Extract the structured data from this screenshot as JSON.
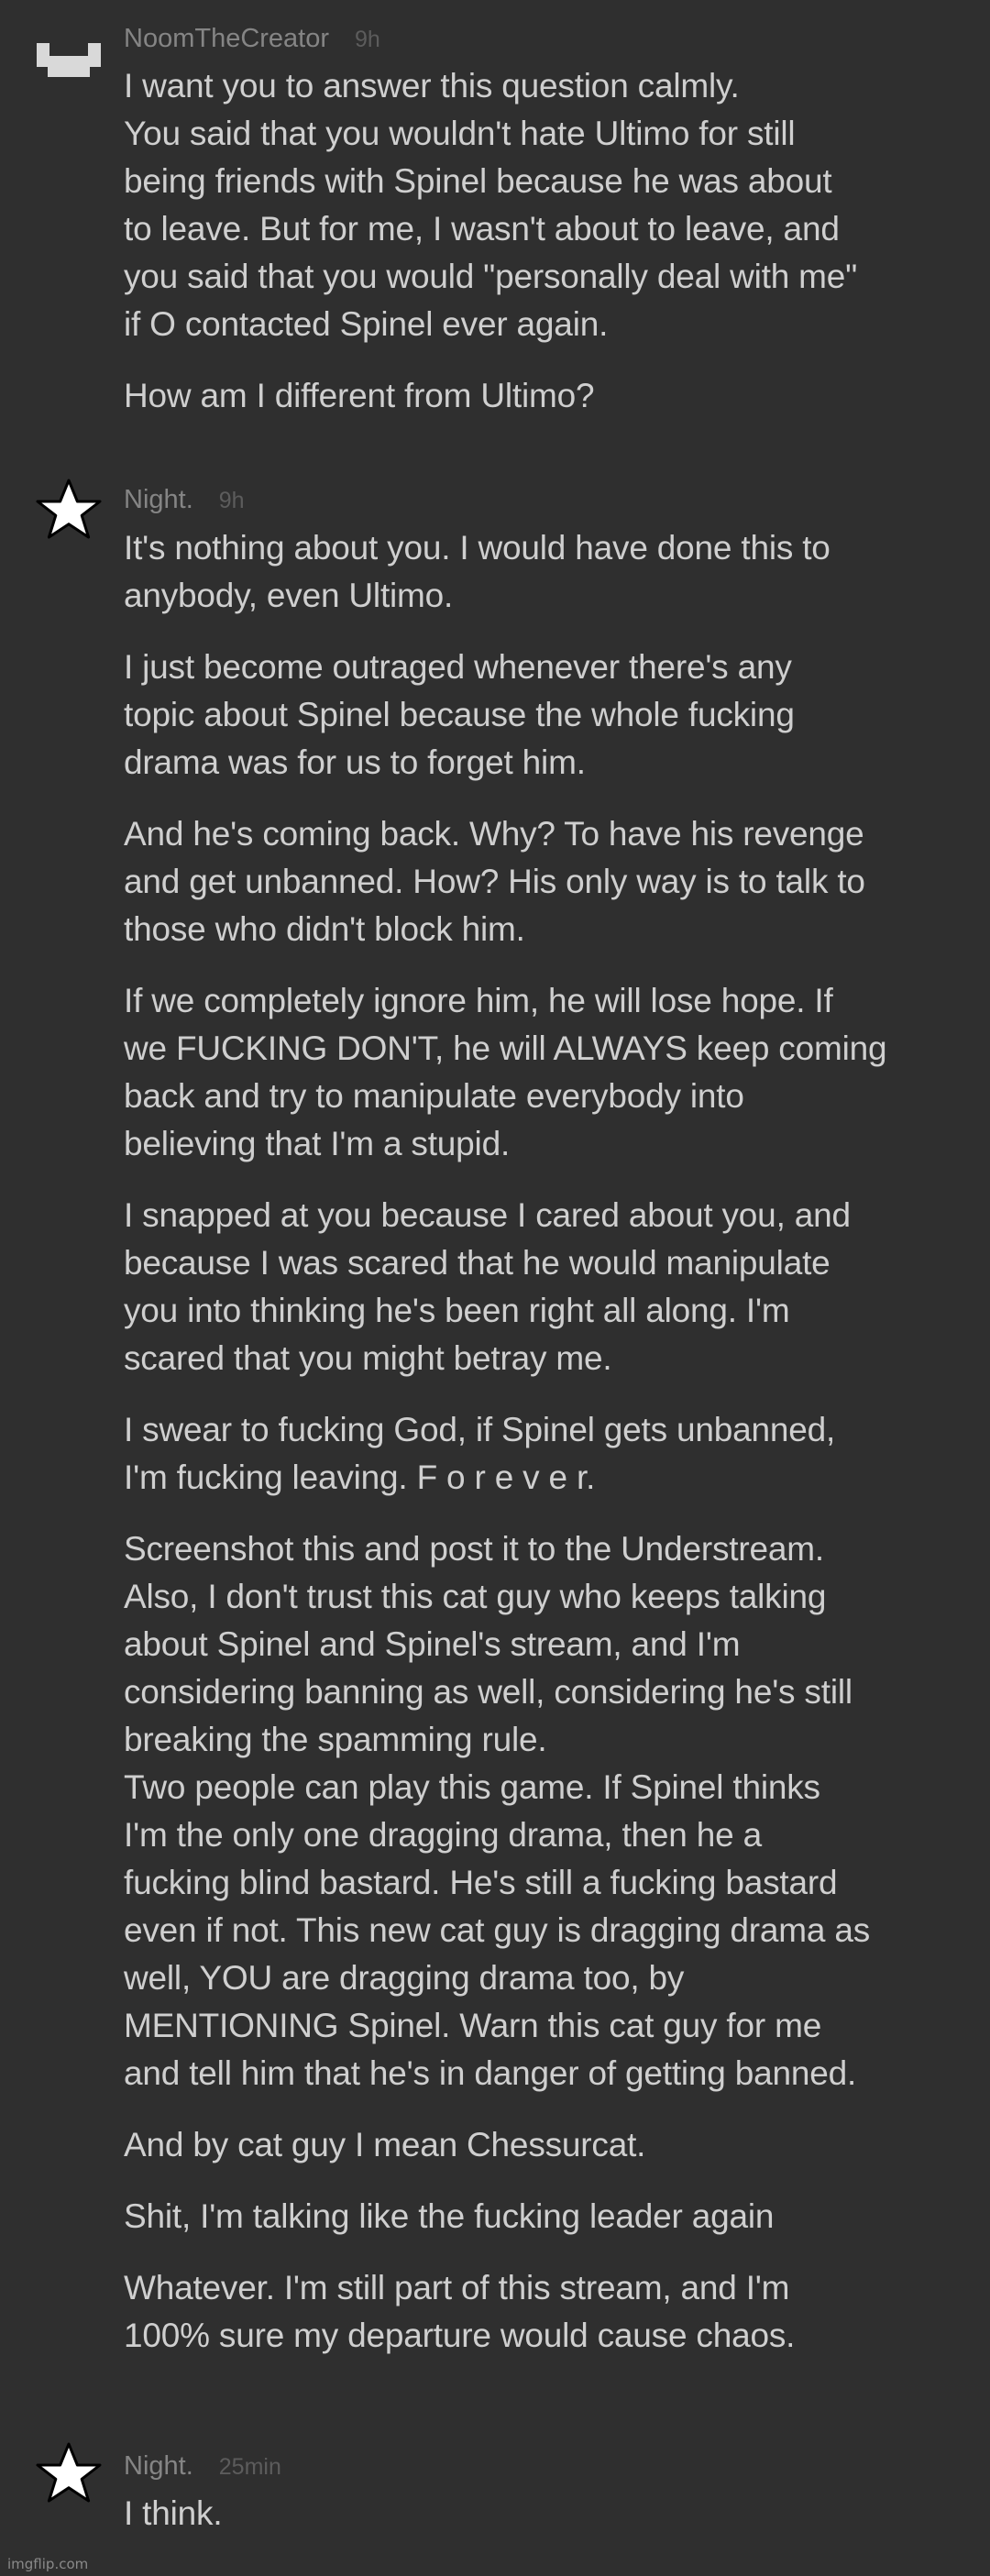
{
  "comments": [
    {
      "author": "NoomTheCreator",
      "time": "9h",
      "avatar_icon": "pixel-face-icon",
      "paragraphs": [
        "I want you to answer this question calmly.\nYou said that you wouldn't hate Ultimo for still\nbeing friends with Spinel because he was about\nto leave. But for me, I wasn't about to leave, and\nyou said that you would \"personally deal with me\"\nif O contacted Spinel ever again.",
        "How am I different from Ultimo?"
      ]
    },
    {
      "author": "Night.",
      "time": "9h",
      "avatar_icon": "star-icon",
      "paragraphs": [
        "It's nothing about you. I would have done this to\nanybody, even Ultimo.",
        "I just become outraged whenever there's any\ntopic about Spinel because the whole fucking\ndrama was for us to forget him.",
        "And he's coming back. Why? To have his revenge\nand get unbanned. How? His only way is to talk to\nthose who didn't block him.",
        "If we completely ignore him, he will lose hope. If\nwe FUCKING DON'T, he will ALWAYS keep coming\nback and try to manipulate everybody into\nbelieving that I'm a stupid.",
        "I snapped at you because I cared about you, and\nbecause I was scared that he would manipulate\nyou into thinking he's been right all along. I'm\nscared that you might betray me.",
        "I swear to fucking God, if Spinel gets unbanned,\nI'm fucking leaving. F o r e v e r.",
        "Screenshot this and post it to the Understream.\nAlso, I don't trust this cat guy who keeps talking\nabout Spinel and Spinel's stream, and I'm\nconsidering banning as well, considering he's still\nbreaking the spamming rule.\nTwo people can play this game. If Spinel thinks\nI'm the only one dragging drama, then he a\nfucking blind bastard. He's still a fucking bastard\neven if not. This new cat guy is dragging drama as\nwell, YOU are dragging drama too, by\nMENTIONING Spinel. Warn this cat guy for me\nand tell him that he's in danger of getting banned.",
        "And by cat guy I mean Chessurcat.",
        "Shit, I'm talking like the fucking leader again",
        "Whatever. I'm still part of this stream, and I'm\n100% sure my departure would cause chaos."
      ]
    },
    {
      "author": "Night.",
      "time": "25min",
      "avatar_icon": "star-icon",
      "paragraphs": [
        "I think."
      ]
    }
  ],
  "watermark": "imgflip.com"
}
